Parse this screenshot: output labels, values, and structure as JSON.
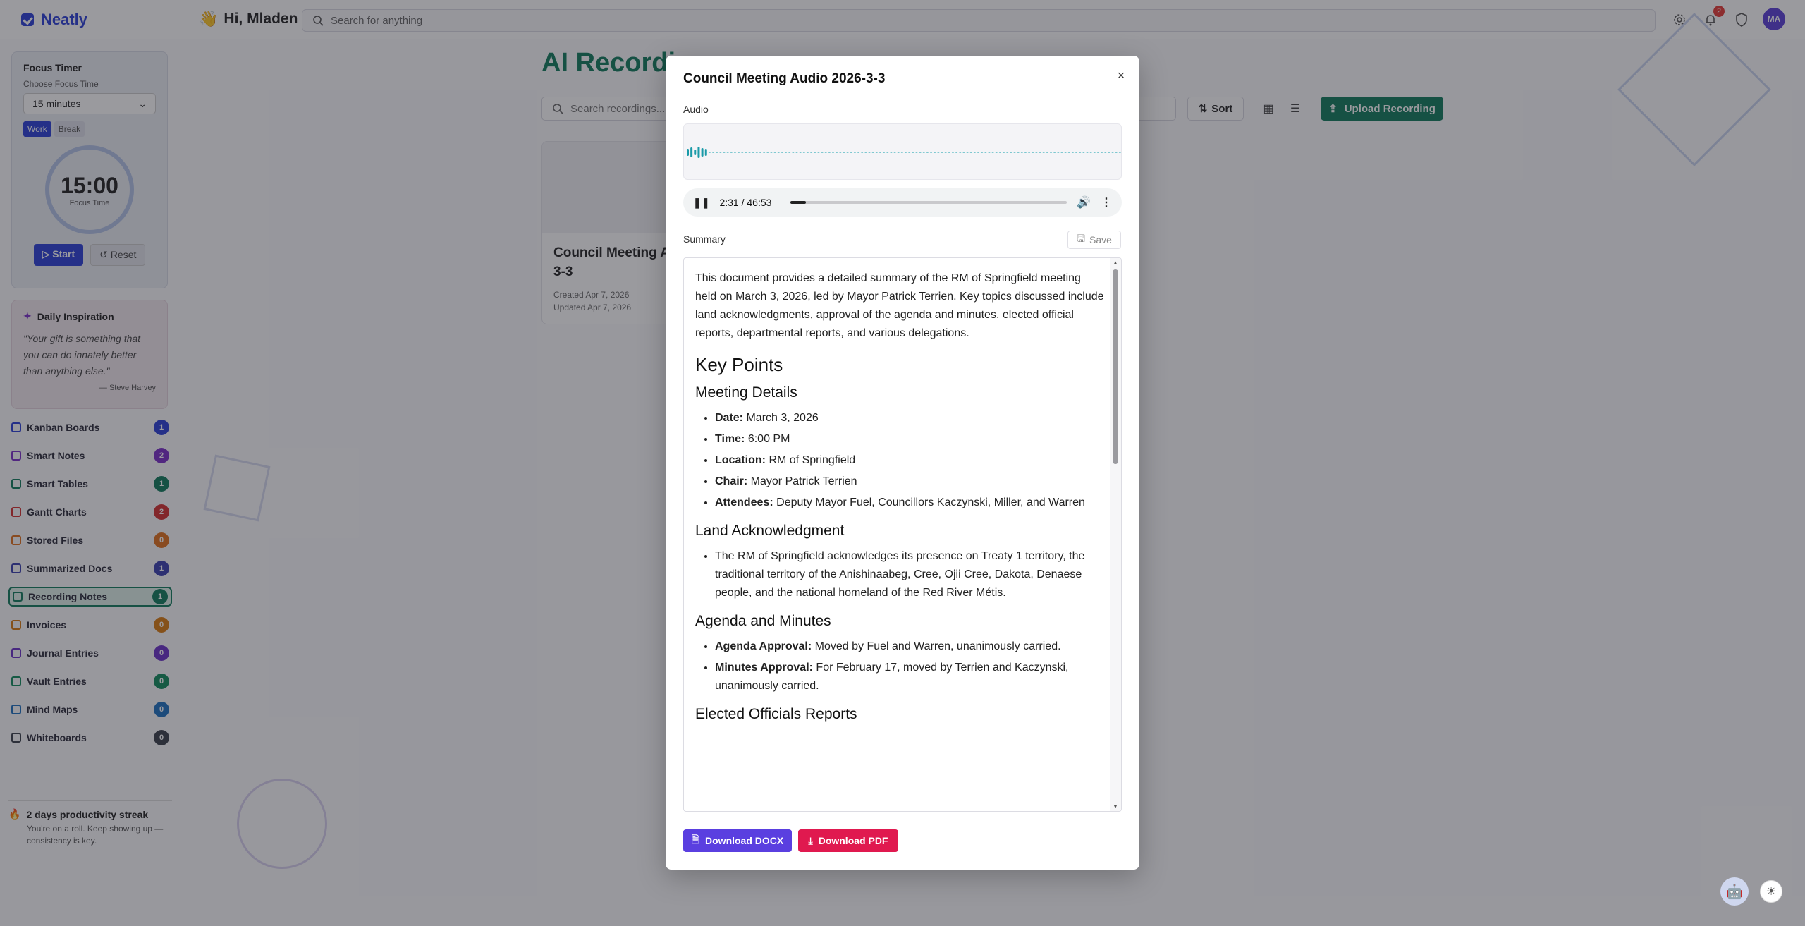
{
  "app": {
    "name": "Neatly",
    "greeting": "Hi, Mladen",
    "search_placeholder": "Search for anything",
    "notification_count": "2",
    "avatar_initials": "MA"
  },
  "focus_timer": {
    "title": "Focus Timer",
    "choose_label": "Choose Focus Time",
    "selected": "15 minutes",
    "modes": [
      "Work",
      "Break"
    ],
    "active_mode": "Work",
    "time": "15:00",
    "time_label": "Focus Time",
    "start": "Start",
    "reset": "Reset"
  },
  "inspiration": {
    "title": "Daily Inspiration",
    "quote": "\"Your gift is something that you can do innately better than anything else.\"",
    "author": "— Steve Harvey"
  },
  "nav": [
    {
      "label": "Kanban Boards",
      "count": "1",
      "color": "#2a3fd8"
    },
    {
      "label": "Smart Notes",
      "count": "2",
      "color": "#7b2fc9"
    },
    {
      "label": "Smart Tables",
      "count": "1",
      "color": "#0f7a5c"
    },
    {
      "label": "Gantt Charts",
      "count": "2",
      "color": "#d32f2f"
    },
    {
      "label": "Stored Files",
      "count": "0",
      "color": "#e0701c"
    },
    {
      "label": "Summarized Docs",
      "count": "1",
      "color": "#3a3fb0"
    },
    {
      "label": "Recording Notes",
      "count": "1",
      "color": "#0f7a5c"
    },
    {
      "label": "Invoices",
      "count": "0",
      "color": "#d97a10"
    },
    {
      "label": "Journal Entries",
      "count": "0",
      "color": "#6a30c9"
    },
    {
      "label": "Vault Entries",
      "count": "0",
      "color": "#0f8a5c"
    },
    {
      "label": "Mind Maps",
      "count": "0",
      "color": "#1c6fc0"
    },
    {
      "label": "Whiteboards",
      "count": "0",
      "color": "#3a3f4a"
    }
  ],
  "streak": {
    "title": "2 days productivity streak",
    "text": "You're on a roll. Keep showing up — consistency is key."
  },
  "main": {
    "title": "AI Recordin",
    "search_placeholder": "Search recordings...",
    "sort": "Sort",
    "upload": "Upload Recording",
    "card": {
      "title": "Council Meeting A 3-3",
      "created": "Created Apr 7, 2026",
      "updated": "Updated Apr 7, 2026"
    }
  },
  "modal": {
    "title": "Council Meeting Audio 2026-3-3",
    "audio_label": "Audio",
    "player_time": "2:31 / 46:53",
    "progress": 0.054,
    "summary_label": "Summary",
    "save": "Save",
    "intro": "This document provides a detailed summary of the RM of Springfield meeting held on March 3, 2026, led by Mayor Patrick Terrien. Key topics discussed include land acknowledgments, approval of the agenda and minutes, elected official reports, departmental reports, and various delegations.",
    "key_points": "Key Points",
    "meeting_details": "Meeting Details",
    "details": [
      {
        "k": "Date:",
        "v": " March 3, 2026"
      },
      {
        "k": "Time:",
        "v": " 6:00 PM"
      },
      {
        "k": "Location:",
        "v": " RM of Springfield"
      },
      {
        "k": "Chair:",
        "v": " Mayor Patrick Terrien"
      },
      {
        "k": "Attendees:",
        "v": " Deputy Mayor Fuel, Councillors Kaczynski, Miller, and Warren"
      }
    ],
    "land_ack_heading": "Land Acknowledgment",
    "land_ack": "The RM of Springfield acknowledges its presence on Treaty 1 territory, the traditional territory of the Anishinaabeg, Cree, Ojii Cree, Dakota, Denaese people, and the national homeland of the Red River Métis.",
    "agenda_heading": "Agenda and Minutes",
    "agenda": [
      {
        "k": "Agenda Approval:",
        "v": " Moved by Fuel and Warren, unanimously carried."
      },
      {
        "k": "Minutes Approval:",
        "v": " For February 17, moved by Terrien and Kaczynski, unanimously carried."
      }
    ],
    "elected_heading": "Elected Officials Reports",
    "download_docx": "Download DOCX",
    "download_pdf": "Download PDF"
  }
}
